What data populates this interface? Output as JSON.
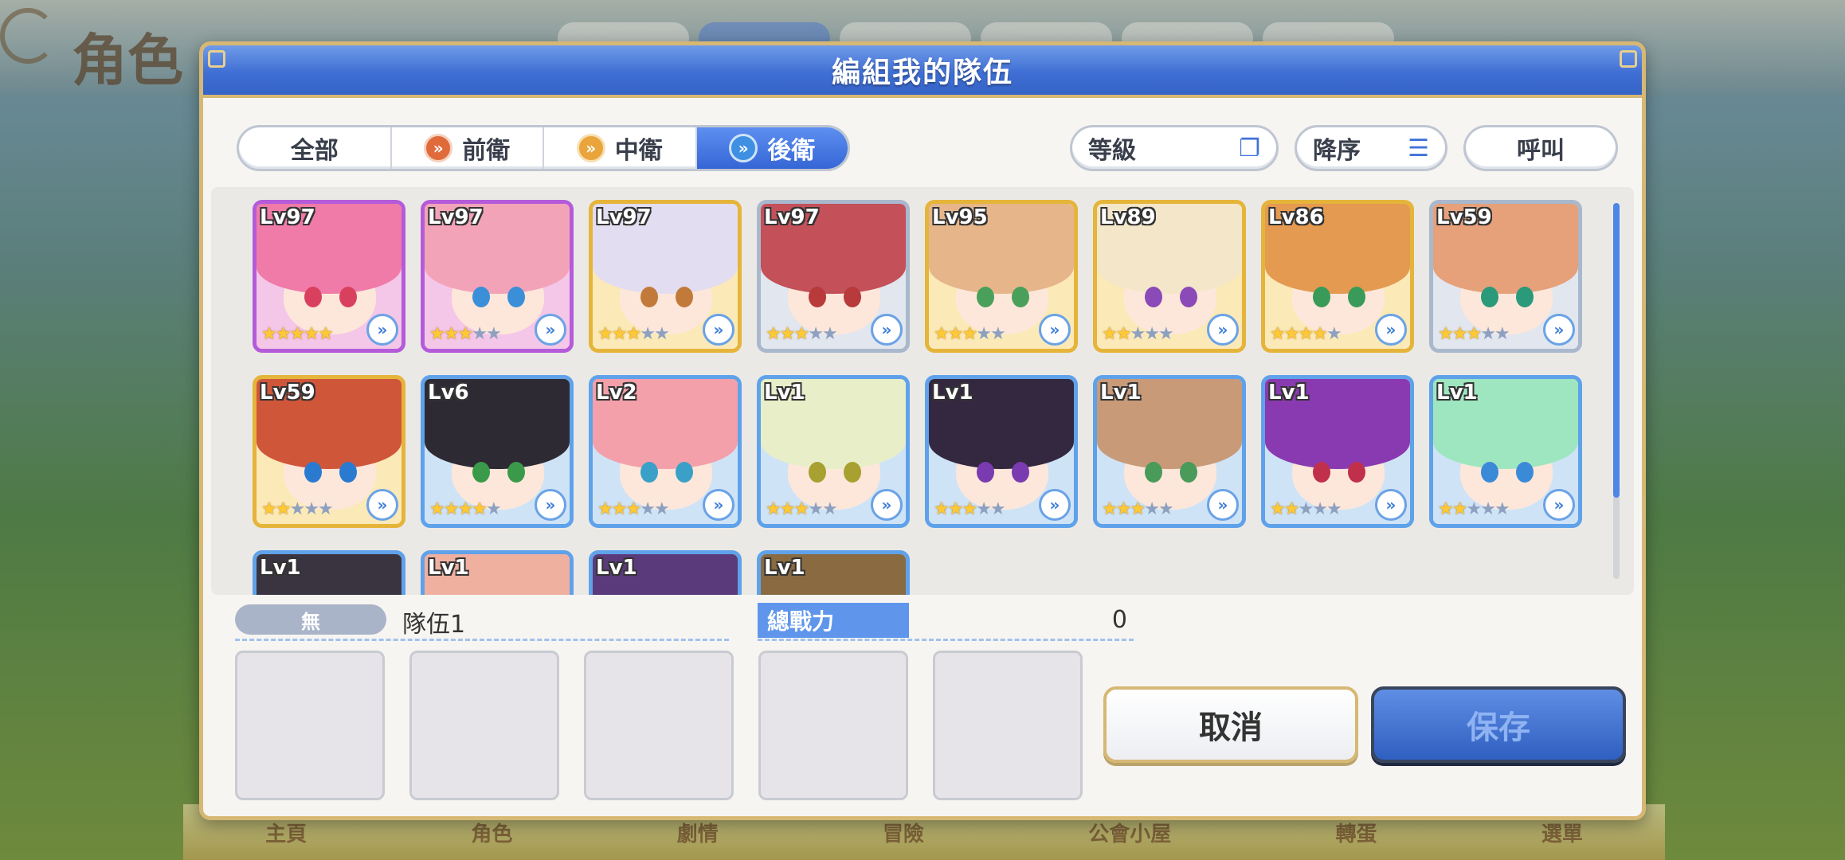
{
  "background": {
    "screen_title": "角色",
    "nav_items": [
      "主頁",
      "角色",
      "劇情",
      "冒險",
      "公會小屋",
      "轉蛋",
      "選單"
    ]
  },
  "dialog": {
    "title": "編組我的隊伍",
    "filter_tabs": [
      {
        "label": "全部",
        "icon": "",
        "selected": false
      },
      {
        "label": "前衛",
        "icon": "front-position-icon",
        "selected": false
      },
      {
        "label": "中衛",
        "icon": "middle-position-icon",
        "selected": false
      },
      {
        "label": "後衛",
        "icon": "back-position-icon",
        "selected": true
      }
    ],
    "sort_field_label": "等級",
    "sort_order_label": "降序",
    "call_label": "呼叫",
    "characters": [
      {
        "level": "Lv97",
        "stars": 5,
        "frame": "purple",
        "hair": "#f07aa8",
        "eyes": "#d9405e"
      },
      {
        "level": "Lv97",
        "stars": 3,
        "frame": "purple",
        "hair": "#f3a3b8",
        "eyes": "#3a8fd8"
      },
      {
        "level": "Lv97",
        "stars": 3,
        "frame": "gold",
        "hair": "#e2ddf0",
        "eyes": "#c27a3a"
      },
      {
        "level": "Lv97",
        "stars": 3,
        "frame": "silver",
        "hair": "#c4505a",
        "eyes": "#b83a3a"
      },
      {
        "level": "Lv95",
        "stars": 3,
        "frame": "gold",
        "hair": "#e6b68a",
        "eyes": "#4aa05a"
      },
      {
        "level": "Lv89",
        "stars": 2,
        "frame": "gold",
        "hair": "#f4e6c8",
        "eyes": "#8a4ab8"
      },
      {
        "level": "Lv86",
        "stars": 4,
        "frame": "gold",
        "hair": "#e49a50",
        "eyes": "#3a9a5a"
      },
      {
        "level": "Lv59",
        "stars": 3,
        "frame": "silver",
        "hair": "#e6a07a",
        "eyes": "#2a9a7a"
      },
      {
        "level": "Lv59",
        "stars": 2,
        "frame": "gold",
        "hair": "#d0563a",
        "eyes": "#2a7ad0"
      },
      {
        "level": "Lv6",
        "stars": 4,
        "frame": "blue",
        "hair": "#2e2a33",
        "eyes": "#3a9a4a"
      },
      {
        "level": "Lv2",
        "stars": 3,
        "frame": "blue",
        "hair": "#f4a0aa",
        "eyes": "#3aa0c8"
      },
      {
        "level": "Lv1",
        "stars": 3,
        "frame": "blue",
        "hair": "#e8eec8",
        "eyes": "#a8a030"
      },
      {
        "level": "Lv1",
        "stars": 3,
        "frame": "blue",
        "hair": "#33283f",
        "eyes": "#7a3ab0"
      },
      {
        "level": "Lv1",
        "stars": 3,
        "frame": "blue",
        "hair": "#c89a78",
        "eyes": "#4a9a5a"
      },
      {
        "level": "Lv1",
        "stars": 2,
        "frame": "blue",
        "hair": "#8a3ab0",
        "eyes": "#c0304a"
      },
      {
        "level": "Lv1",
        "stars": 2,
        "frame": "blue",
        "hair": "#9ee6c0",
        "eyes": "#3a8ad8"
      },
      {
        "level": "Lv1",
        "stars": 0,
        "frame": "blue",
        "hair": "#3a3440",
        "eyes": "#555555"
      },
      {
        "level": "Lv1",
        "stars": 0,
        "frame": "blue",
        "hair": "#f0b0a0",
        "eyes": "#555555"
      },
      {
        "level": "Lv1",
        "stars": 0,
        "frame": "blue",
        "hair": "#5a3a7a",
        "eyes": "#555555"
      },
      {
        "level": "Lv1",
        "stars": 0,
        "frame": "blue",
        "hair": "#8a6a40",
        "eyes": "#555555"
      }
    ],
    "team": {
      "tag": "無",
      "name": "隊伍1",
      "power_label": "總戰力",
      "power_value": "0",
      "slots": 5
    },
    "cancel_label": "取消",
    "save_label": "保存"
  }
}
